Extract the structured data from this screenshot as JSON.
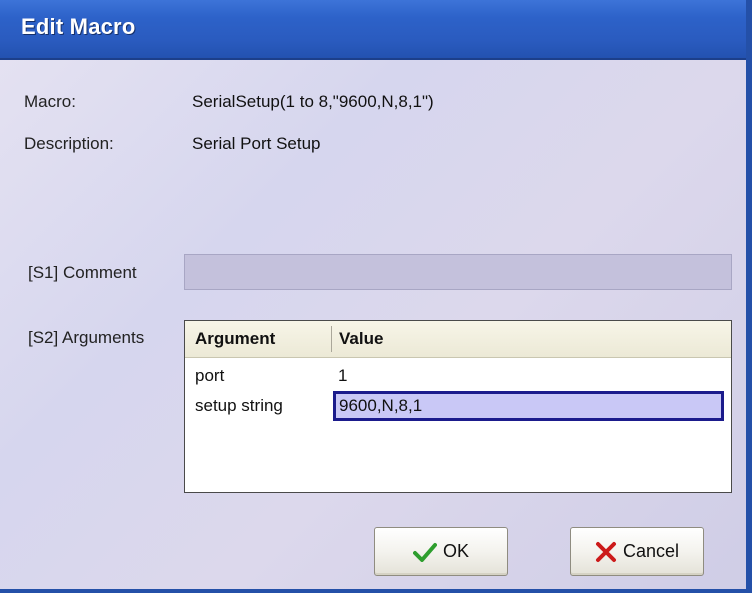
{
  "window": {
    "title": "Edit Macro"
  },
  "info": {
    "macro_label": "Macro:",
    "macro_value": "SerialSetup(1 to 8,\"9600,N,8,1\")",
    "description_label": "Description:",
    "description_value": "Serial Port Setup"
  },
  "comment": {
    "label": "[S1] Comment",
    "value": ""
  },
  "arguments": {
    "label": "[S2] Arguments",
    "columns": [
      "Argument",
      "Value"
    ],
    "rows": [
      {
        "argument": "port",
        "value": "1"
      },
      {
        "argument": "setup string",
        "value": "9600,N,8,1"
      }
    ]
  },
  "buttons": {
    "ok": "OK",
    "cancel": "Cancel"
  },
  "icons": {
    "ok": "checkmark-icon",
    "cancel": "x-icon"
  },
  "colors": {
    "titlebar": "#2a5bbf",
    "selection_border": "#1b1b8c",
    "ok_check": "#2e9e2e",
    "cancel_x": "#cc1a1a"
  }
}
